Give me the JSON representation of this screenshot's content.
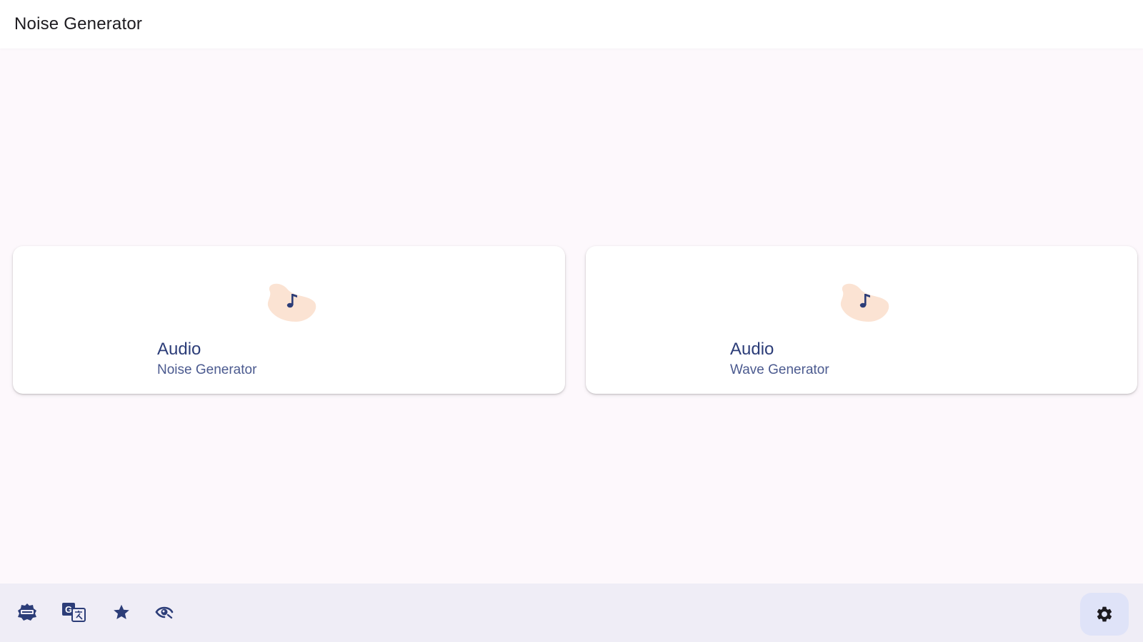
{
  "header": {
    "title": "Noise Generator"
  },
  "cards": [
    {
      "title": "Audio",
      "subtitle": "Noise Generator",
      "icon": "music-note-icon"
    },
    {
      "title": "Audio",
      "subtitle": "Wave Generator",
      "icon": "music-note-icon"
    }
  ],
  "bottom_nav": {
    "items": [
      {
        "icon": "badge-icon"
      },
      {
        "icon": "translate-icon"
      },
      {
        "icon": "star-icon"
      },
      {
        "icon": "eye-icon"
      }
    ],
    "settings": {
      "icon": "gear-icon"
    }
  },
  "colors": {
    "background": "#fdf8fc",
    "primary": "#2c3d78",
    "blob": "#fbe3d3",
    "bottom_bar": "#efedf6",
    "settings_bg": "#dfe3f8"
  }
}
